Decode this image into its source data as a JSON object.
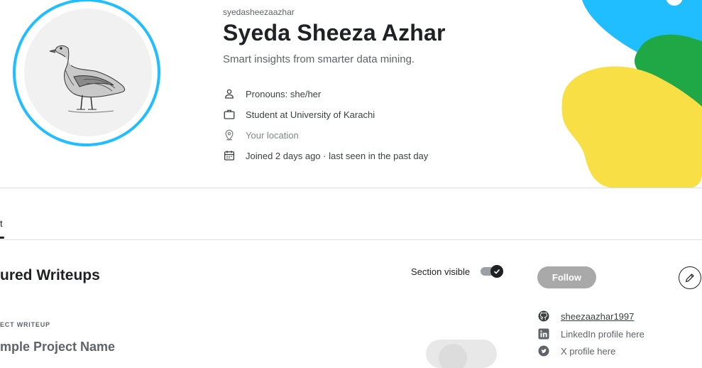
{
  "profile": {
    "username": "syedasheezaazhar",
    "display_name": "Syeda Sheeza Azhar",
    "tagline": "Smart insights from smarter data mining.",
    "avatar_icon": "goose-illustration",
    "meta": [
      {
        "icon": "person-icon",
        "text": "Pronouns: she/her"
      },
      {
        "icon": "briefcase-icon",
        "text": "Student at University of Karachi"
      },
      {
        "icon": "location-pin-icon",
        "text": "Your location"
      },
      {
        "icon": "calendar-icon",
        "text": "Joined 2 days ago · last seen in the past day"
      }
    ]
  },
  "tabs": {
    "active_label": "t"
  },
  "featured": {
    "title": "ured Writeups",
    "visible_label": "Section visible",
    "visible_on": true,
    "kicker": "ECT WRITEUP",
    "project_title": "mple Project Name"
  },
  "sidebar": {
    "follow_label": "Follow",
    "social": [
      {
        "icon": "github-icon",
        "text": "sheezaazhar1997",
        "link": true
      },
      {
        "icon": "linkedin-icon",
        "text": "LinkedIn profile here",
        "link": false
      },
      {
        "icon": "twitter-icon",
        "text": "X profile here",
        "link": false
      }
    ]
  },
  "colors": {
    "accent_ring": "#20beff",
    "blob_blue": "#20beff",
    "blob_green": "#20a846",
    "blob_yellow": "#f8df45"
  }
}
